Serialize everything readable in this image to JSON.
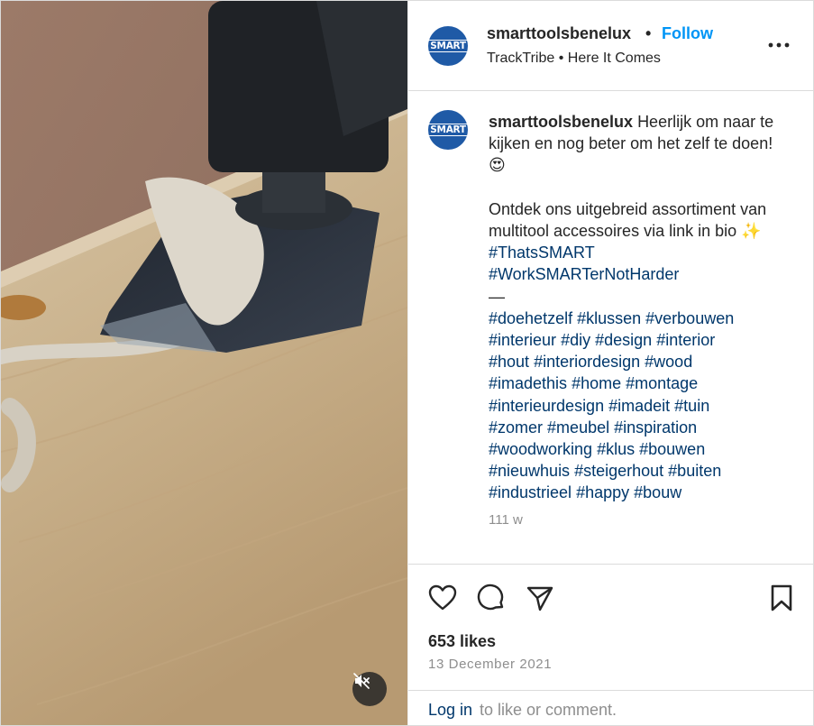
{
  "media": {
    "mute_icon": "speaker-muted-icon"
  },
  "header": {
    "avatar_text": "SMART",
    "username": "smarttoolsbenelux",
    "separator": "•",
    "follow_label": "Follow",
    "audio_artist": "TrackTribe",
    "audio_sep": "•",
    "audio_title": "Here It Comes",
    "more_icon": "more-options-icon"
  },
  "caption": {
    "avatar_text": "SMART",
    "username": "smarttoolsbenelux",
    "line1": "Heerlijk om naar te kijken en nog beter om het zelf te doen! 😍",
    "line2": "Ontdek ons uitgebreid assortiment van multitool accessoires via link in bio ✨",
    "tags_a": [
      "#ThatsSMART",
      "#WorkSMARTerNotHarder"
    ],
    "dash": "—",
    "tags_b": [
      "#doehetzelf",
      "#klussen",
      "#verbouwen",
      "#interieur",
      "#diy",
      "#design",
      "#interior",
      "#hout",
      "#interiordesign",
      "#wood",
      "#imadethis",
      "#home",
      "#montage",
      "#interieurdesign",
      "#imadeit",
      "#tuin",
      "#zomer",
      "#meubel",
      "#inspiration",
      "#woodworking",
      "#klus",
      "#bouwen",
      "#nieuwhuis",
      "#steigerhout",
      "#buiten",
      "#industrieel",
      "#happy",
      "#bouw"
    ],
    "time": "111 w"
  },
  "actions": {
    "like_icon": "heart-icon",
    "comment_icon": "comment-icon",
    "share_icon": "share-icon",
    "save_icon": "bookmark-icon",
    "likes": "653 likes",
    "date": "13 December 2021"
  },
  "login": {
    "link": "Log in",
    "rest": "to like or comment."
  }
}
